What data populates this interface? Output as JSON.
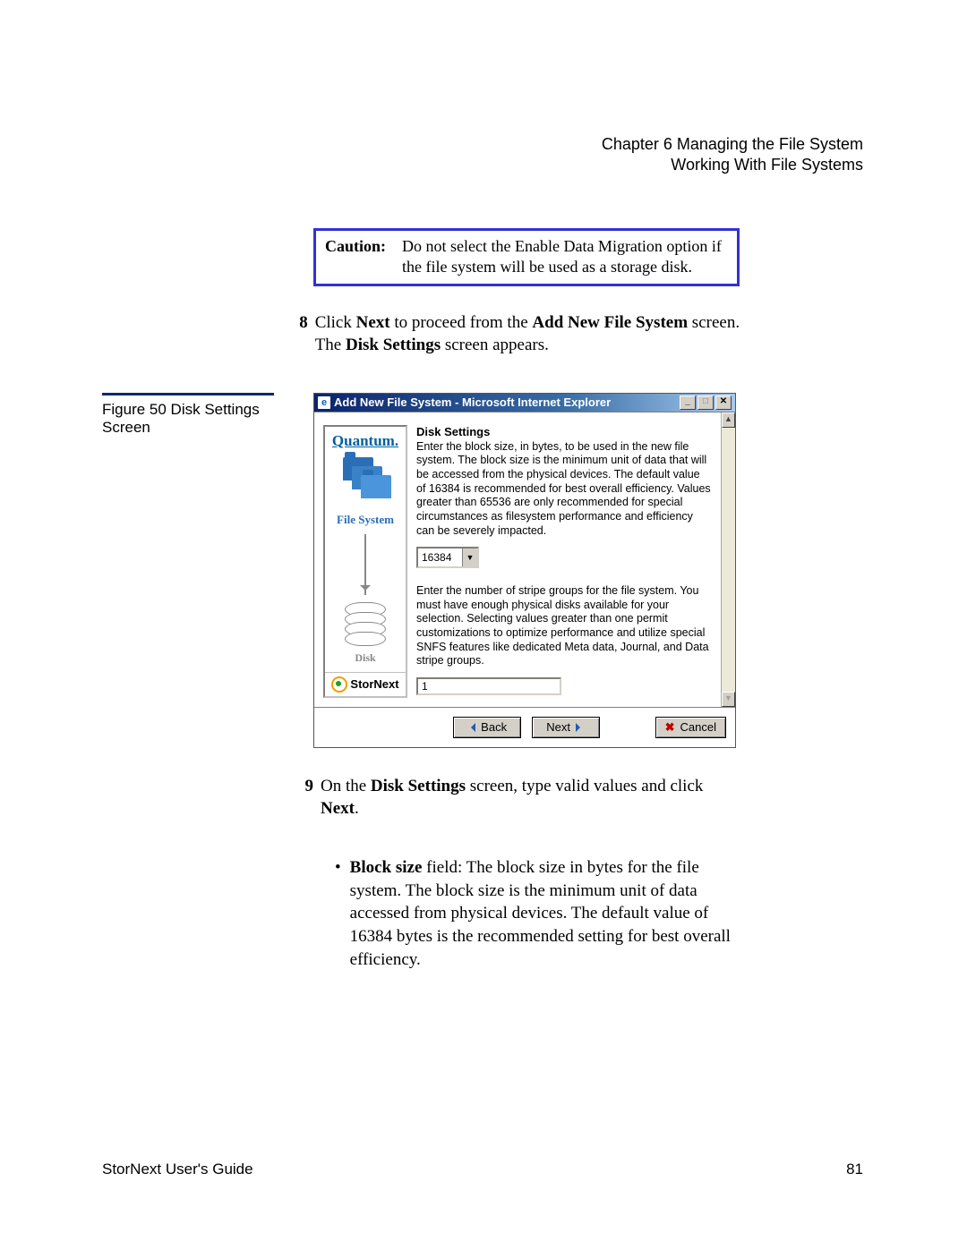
{
  "header": {
    "chapter": "Chapter 6  Managing the File System",
    "section": "Working With File Systems"
  },
  "caution": {
    "label": "Caution:",
    "text": "Do not select the Enable Data Migration option if the file system will be used as a storage disk."
  },
  "step8": {
    "num": "8",
    "pre": "Click ",
    "b1": "Next",
    "mid": " to proceed from the ",
    "b2": "Add New File System",
    "mid2": " screen. The ",
    "b3": "Disk Settings",
    "post": " screen appears."
  },
  "figure": {
    "caption": "Figure 50  Disk Settings Screen"
  },
  "shot": {
    "title": "Add New File System - Microsoft Internet Explorer",
    "min": "_",
    "max": "□",
    "close": "✕",
    "brand": "Quantum.",
    "fs_label": "File System",
    "disk_label": "Disk",
    "stornext": "StorNext",
    "heading": "Disk Settings",
    "p1": "Enter the block size, in bytes, to be used in the new file system. The block size is the minimum unit of data that will be accessed from the physical devices. The default value of 16384 is recommended for best overall efficiency. Values greater than 65536 are only recommended for special circumstances as filesystem performance and efficiency can be severely impacted.",
    "block_size": "16384",
    "p2": "Enter the number of stripe groups for the file system. You must have enough physical disks available for your selection. Selecting values greater than one permit customizations to optimize performance and utilize special SNFS features like dedicated Meta data, Journal, and Data stripe groups.",
    "stripe_groups": "1",
    "back": "Back",
    "next": "Next",
    "cancel": "Cancel"
  },
  "step9": {
    "num": "9",
    "pre": "On the ",
    "b1": "Disk Settings",
    "mid": " screen, type valid values and click ",
    "b2": "Next",
    "post": "."
  },
  "bullet1": {
    "b1": "Block size",
    "rest": " field: The block size in bytes for the file system. The block size is the minimum unit of data accessed from physical devices. The default value of 16384 bytes is the recommended setting for best overall efficiency."
  },
  "footer": {
    "left": "StorNext User's Guide",
    "right": "81"
  }
}
